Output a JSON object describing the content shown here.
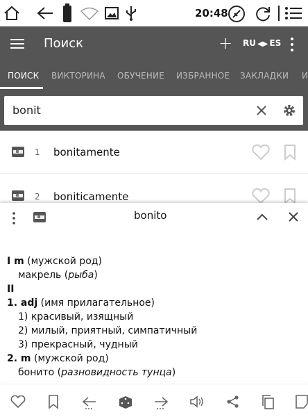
{
  "statusbar": {
    "time": "20:48"
  },
  "appbar": {
    "title": "Поиск",
    "add_label": "+",
    "lang_from": "RU",
    "lang_to": "ES"
  },
  "tabs": [
    {
      "label": "ПОИСК",
      "active": true
    },
    {
      "label": "ВИКТОРИНА",
      "active": false
    },
    {
      "label": "ОБУЧЕНИЕ",
      "active": false
    },
    {
      "label": "ИЗБРАННОЕ",
      "active": false
    },
    {
      "label": "ЗАКЛАДКИ",
      "active": false
    },
    {
      "label": "И",
      "active": false
    }
  ],
  "search": {
    "value": "bonit"
  },
  "results": [
    {
      "index": "1",
      "word": "bonitamente"
    },
    {
      "index": "2",
      "word": "boniticamente"
    }
  ],
  "panel": {
    "headword": "bonito",
    "lines": [
      {
        "pre": "",
        "bold": "I m",
        "text": " (мужской род)",
        "italic": "",
        "post": "",
        "indent": 0
      },
      {
        "pre": "макрель (",
        "bold": "",
        "text": "",
        "italic": "рыба",
        "post": ")",
        "indent": 1
      },
      {
        "pre": "",
        "bold": "II",
        "text": "",
        "italic": "",
        "post": "",
        "indent": 0
      },
      {
        "pre": "",
        "bold": "1. adj",
        "text": " (имя прилагательное)",
        "italic": "",
        "post": "",
        "indent": 0
      },
      {
        "pre": "1) красивый, изящный",
        "bold": "",
        "text": "",
        "italic": "",
        "post": "",
        "indent": 1
      },
      {
        "pre": "2) милый, приятный, симпатичный",
        "bold": "",
        "text": "",
        "italic": "",
        "post": "",
        "indent": 1
      },
      {
        "pre": "3) прекрасный, чудный",
        "bold": "",
        "text": "",
        "italic": "",
        "post": "",
        "indent": 1
      },
      {
        "pre": "",
        "bold": "2. m",
        "text": " (мужской род)",
        "italic": "",
        "post": "",
        "indent": 0
      },
      {
        "pre": "бонито (",
        "bold": "",
        "text": "",
        "italic": "разновидность тунца",
        "post": ")",
        "indent": 1
      }
    ]
  },
  "colors": {
    "toolbar_bg": "#555555",
    "tab_inactive": "#bbbbbb",
    "icon_gray": "#666666"
  }
}
